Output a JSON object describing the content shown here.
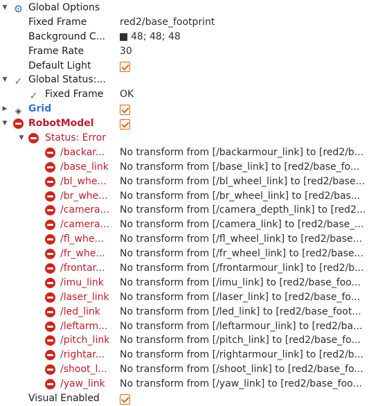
{
  "global_options": {
    "label": "Global Options",
    "fixed_frame": {
      "label": "Fixed Frame",
      "value": "red2/base_footprint"
    },
    "background_color": {
      "label": "Background C...",
      "value": "48; 48; 48",
      "swatch": "#303030"
    },
    "frame_rate": {
      "label": "Frame Rate",
      "value": "30"
    },
    "default_light": {
      "label": "Default Light",
      "checked": true
    }
  },
  "global_status": {
    "label": "Global Status:...",
    "fixed_frame": {
      "label": "Fixed Frame",
      "value": "OK"
    }
  },
  "grid": {
    "label": "Grid",
    "checked": true
  },
  "robot_model": {
    "label": "RobotModel",
    "checked": true,
    "status": {
      "label": "Status: Error",
      "links": [
        {
          "label": "/backar...",
          "message": "No transform from [/backarmour_link] to [red2/b..."
        },
        {
          "label": "/base_link",
          "message": "No transform from [/base_link] to [red2/base_fo..."
        },
        {
          "label": "/bl_whe...",
          "message": "No transform from [/bl_wheel_link] to [red2/base..."
        },
        {
          "label": "/br_whe...",
          "message": "No transform from [/br_wheel_link] to [red2/bas..."
        },
        {
          "label": "/camera...",
          "message": "No transform from [/camera_depth_link] to [red2..."
        },
        {
          "label": "/camera...",
          "message": "No transform from [/camera_link] to [red2/base_..."
        },
        {
          "label": "/fl_whe...",
          "message": "No transform from [/fl_wheel_link] to [red2/base..."
        },
        {
          "label": "/fr_whe...",
          "message": "No transform from [/fr_wheel_link] to [red2/base..."
        },
        {
          "label": "/frontar...",
          "message": "No transform from [/frontarmour_link] to [red2/b..."
        },
        {
          "label": "/imu_link",
          "message": "No transform from [/imu_link] to [red2/base_foo..."
        },
        {
          "label": "/laser_link",
          "message": "No transform from [/laser_link] to [red2/base_fo..."
        },
        {
          "label": "/led_link",
          "message": "No transform from [/led_link] to [red2/base_foot..."
        },
        {
          "label": "/leftarm...",
          "message": "No transform from [/leftarmour_link] to [red2/ba..."
        },
        {
          "label": "/pitch_link",
          "message": "No transform from [/pitch_link] to [red2/base_fo..."
        },
        {
          "label": "/rightar...",
          "message": "No transform from [/rightarmour_link] to [red2/b..."
        },
        {
          "label": "/shoot_l...",
          "message": "No transform from [/shoot_link] to [red2/base_fo..."
        },
        {
          "label": "/yaw_link",
          "message": "No transform from [/yaw_link] to [red2/base_foo..."
        }
      ]
    },
    "visual_enabled": {
      "label": "Visual Enabled",
      "checked": true
    }
  },
  "colors": {
    "error_red": "#d0241c",
    "ok_green": "#2f8e2f",
    "link_blue": "#3a6fd8",
    "checkbox_orange": "#d66c1c"
  },
  "icons": {
    "global_options": "gear-icon",
    "status_ok": "checkmark-icon",
    "grid": "grid-display-icon",
    "error": "error-icon",
    "expanded": "triangle-down-icon",
    "collapsed": "triangle-right-icon"
  }
}
